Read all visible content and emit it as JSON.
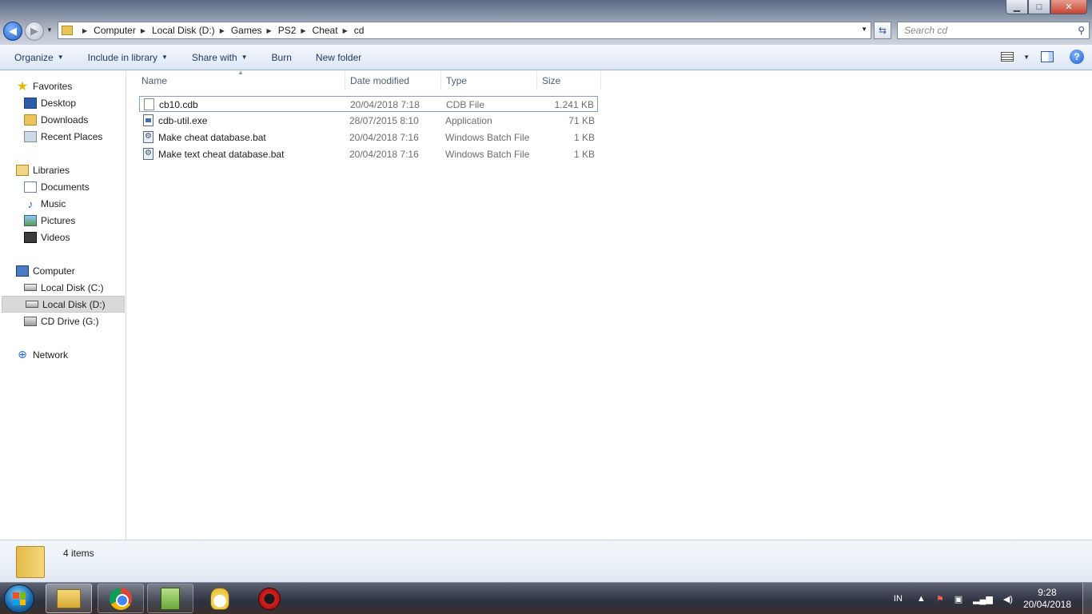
{
  "window": {
    "minimize_glyph": "▁",
    "maximize_glyph": "□",
    "close_glyph": "✕"
  },
  "address": {
    "crumbs": [
      "Computer",
      "Local Disk (D:)",
      "Games",
      "PS2",
      "Cheat",
      "cd"
    ],
    "search_placeholder": "Search cd"
  },
  "toolbar": {
    "organize": "Organize",
    "include_in_library": "Include in library",
    "share_with": "Share with",
    "burn": "Burn",
    "new_folder": "New folder",
    "help_glyph": "?"
  },
  "sidebar": {
    "favorites": "Favorites",
    "desktop": "Desktop",
    "downloads": "Downloads",
    "recent_places": "Recent Places",
    "libraries": "Libraries",
    "documents": "Documents",
    "music": "Music",
    "pictures": "Pictures",
    "videos": "Videos",
    "computer": "Computer",
    "local_disk_c": "Local Disk (C:)",
    "local_disk_d": "Local Disk (D:)",
    "cd_drive_g": "CD Drive (G:)",
    "network": "Network"
  },
  "columns": {
    "name": "Name",
    "date_modified": "Date modified",
    "type": "Type",
    "size": "Size"
  },
  "files": [
    {
      "name": "cb10.cdb",
      "date": "20/04/2018 7:18",
      "type": "CDB File",
      "size": "1.241 KB"
    },
    {
      "name": "cdb-util.exe",
      "date": "28/07/2015 8:10",
      "type": "Application",
      "size": "71 KB"
    },
    {
      "name": "Make cheat database.bat",
      "date": "20/04/2018 7:16",
      "type": "Windows Batch File",
      "size": "1 KB"
    },
    {
      "name": "Make text cheat database.bat",
      "date": "20/04/2018 7:16",
      "type": "Windows Batch File",
      "size": "1 KB"
    }
  ],
  "status": {
    "item_count": "4 items"
  },
  "taskbar": {
    "language": "IN",
    "time": "9:28",
    "date": "20/04/2018",
    "apps": [
      "windows-explorer",
      "google-chrome",
      "notepad-plus-plus",
      "tux-app",
      "red-circle-app"
    ]
  }
}
